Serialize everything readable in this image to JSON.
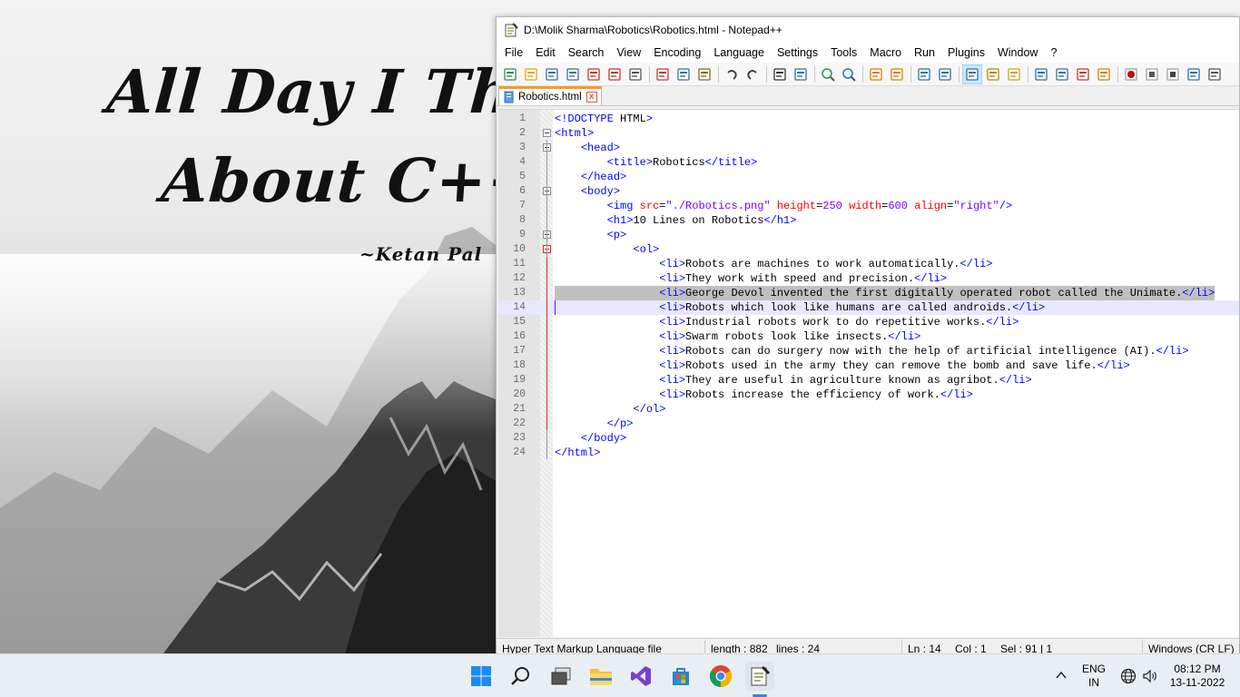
{
  "wallpaper": {
    "quote_line1": "All Day I Think",
    "quote_line2": "About C++",
    "quote_author": "~Ketan Pal"
  },
  "window": {
    "title": "D:\\Molik Sharma\\Robotics\\Robotics.html - Notepad++",
    "app_icon": "notepad-plus-plus-icon"
  },
  "menu": [
    "File",
    "Edit",
    "Search",
    "View",
    "Encoding",
    "Language",
    "Settings",
    "Tools",
    "Macro",
    "Run",
    "Plugins",
    "Window",
    "?"
  ],
  "toolbar": {
    "buttons": [
      "new-file",
      "open-file",
      "save",
      "save-all",
      "close",
      "close-all",
      "print",
      "cut",
      "copy",
      "paste",
      "undo",
      "redo",
      "find",
      "replace",
      "zoom-in",
      "zoom-out",
      "sync-vertical",
      "sync-horizontal",
      "word-wrap",
      "show-all-chars",
      "indent-guide",
      "udl",
      "doc-map",
      "doc-list",
      "function-list",
      "folder-workspace",
      "monitoring",
      "record-macro",
      "stop-record",
      "playback",
      "run-multiple",
      "save-macro"
    ]
  },
  "tab": {
    "label": "Robotics.html",
    "close_label": "x"
  },
  "code_lines": [
    {
      "n": "1",
      "text": "<!DOCTYPE HTML>"
    },
    {
      "n": "2",
      "text": "<html>"
    },
    {
      "n": "3",
      "text": "    <head>"
    },
    {
      "n": "4",
      "text": "        <title>Robotics</title>"
    },
    {
      "n": "5",
      "text": "    </head>"
    },
    {
      "n": "6",
      "text": "    <body>"
    },
    {
      "n": "7",
      "text": "        <img src=\"./Robotics.png\" height=250 width=600 align=\"right\"/>"
    },
    {
      "n": "8",
      "text": "        <h1>10 Lines on Robotics</h1>"
    },
    {
      "n": "9",
      "text": "        <p>"
    },
    {
      "n": "10",
      "text": "            <ol>"
    },
    {
      "n": "11",
      "text": "                <li>Robots are machines to work automatically.</li>"
    },
    {
      "n": "12",
      "text": "                <li>They work with speed and precision.</li>"
    },
    {
      "n": "13",
      "text": "                <li>George Devol invented the first digitally operated robot called the Unimate.</li>"
    },
    {
      "n": "14",
      "text": "                <li>Robots which look like humans are called androids.</li>"
    },
    {
      "n": "15",
      "text": "                <li>Industrial robots work to do repetitive works.</li>"
    },
    {
      "n": "16",
      "text": "                <li>Swarm robots look like insects.</li>"
    },
    {
      "n": "17",
      "text": "                <li>Robots can do surgery now with the help of artificial intelligence (AI).</li>"
    },
    {
      "n": "18",
      "text": "                <li>Robots used in the army they can remove the bomb and save life.</li>"
    },
    {
      "n": "19",
      "text": "                <li>They are useful in agriculture known as agribot.</li>"
    },
    {
      "n": "20",
      "text": "                <li>Robots increase the efficiency of work.</li>"
    },
    {
      "n": "21",
      "text": "            </ol>"
    },
    {
      "n": "22",
      "text": "        </p>"
    },
    {
      "n": "23",
      "text": "    </body>"
    },
    {
      "n": "24",
      "text": "</html>"
    }
  ],
  "editor_state": {
    "selected_line": "13",
    "current_line": "14"
  },
  "statusbar": {
    "filetype": "Hyper Text Markup Language file",
    "length": "length : 882",
    "lines": "lines : 24",
    "ln": "Ln : 14",
    "col": "Col : 1",
    "sel": "Sel : 91 | 1",
    "eol": "Windows (CR LF)"
  },
  "taskbar": {
    "apps": [
      "windows-start-icon",
      "search-icon",
      "task-view-icon",
      "file-explorer-icon",
      "visual-studio-icon",
      "microsoft-store-icon",
      "chrome-icon",
      "notepad-plus-plus-icon"
    ],
    "active_app": "notepad-plus-plus-icon",
    "tray": {
      "lang_top": "ENG",
      "lang_bottom": "IN",
      "time": "08:12 PM",
      "date": "13-11-2022"
    }
  }
}
